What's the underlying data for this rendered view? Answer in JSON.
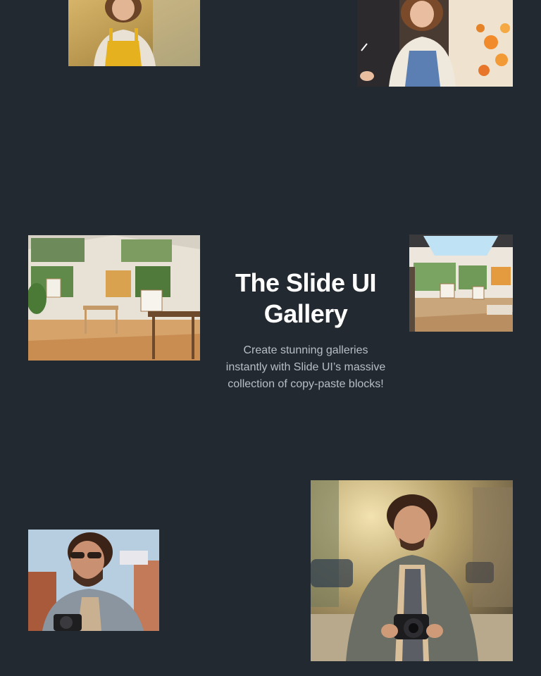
{
  "hero": {
    "title": "The Slide UI Gallery",
    "description": "Create stunning galleries instantly with Slide UI’s massive collection of copy-paste blocks!"
  },
  "colors": {
    "background": "#232930",
    "title": "#ffffff",
    "description": "#b8bec6"
  },
  "gallery": {
    "images": [
      {
        "id": "woman-field",
        "subject": "smiling woman in yellow overalls in sunny field"
      },
      {
        "id": "woman-painting",
        "subject": "smiling woman painting with orange flowers"
      },
      {
        "id": "studio-left",
        "subject": "bright art studio with easels and canvases"
      },
      {
        "id": "studio-right",
        "subject": "sunlit art studio with skylights"
      },
      {
        "id": "man-sunglasses",
        "subject": "bearded man in sunglasses with camera"
      },
      {
        "id": "man-street",
        "subject": "smiling curly-haired man holding camera on street"
      }
    ]
  }
}
